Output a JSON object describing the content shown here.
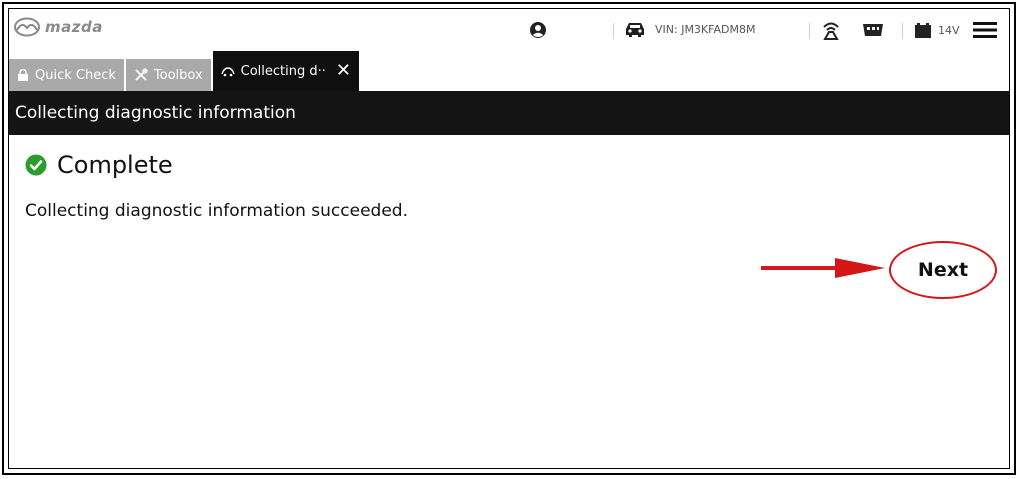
{
  "app": {
    "brand": "mazda"
  },
  "header": {
    "vin_label": "VIN: JM3KFADM8M",
    "battery_voltage": "14V"
  },
  "tabs": [
    {
      "label": "Quick Check",
      "icon": "lock-icon"
    },
    {
      "label": "Toolbox",
      "icon": "tools-icon"
    },
    {
      "label": "Collecting d··",
      "icon": "car-gauge-icon",
      "active": true
    }
  ],
  "page": {
    "title": "Collecting diagnostic information",
    "status": "Complete",
    "message": "Collecting diagnostic information succeeded.",
    "next_label": "Next"
  },
  "colors": {
    "header_bg": "#141414",
    "tab_inactive": "#a9a9a9",
    "success_green": "#2a9d2a",
    "annotation_red": "#d41616"
  }
}
